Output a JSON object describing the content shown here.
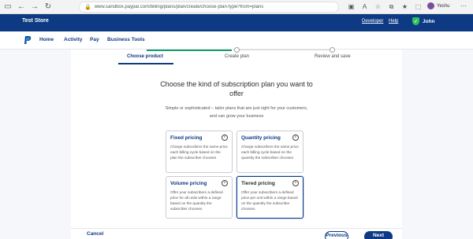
{
  "browser": {
    "url": "www.sandbox.paypal.com/billing/plans/plan/create/choose-plan-type?from=plans",
    "profile_name": "Yeshu"
  },
  "header": {
    "store_name": "Test Store",
    "developer_label": "Developer",
    "help_label": "Help",
    "user_name": "John"
  },
  "nav": {
    "items": [
      {
        "label": "Home"
      },
      {
        "label": "Activity"
      },
      {
        "label": "Pay"
      },
      {
        "label": "Business Tools"
      }
    ]
  },
  "stepper": {
    "steps": [
      {
        "label": "Choose product",
        "state": "active"
      },
      {
        "label": "Create plan",
        "state": "current"
      },
      {
        "label": "Review and save",
        "state": "upcoming"
      }
    ]
  },
  "main": {
    "heading": "Choose the kind of subscription plan you want to offer",
    "subheading": "Simple or sophisticated – tailor plans that are just right for your customers, and can grow your business",
    "options": [
      {
        "title": "Fixed pricing",
        "description": "Charge subscribers the same price each billing cycle based on the plan the subscriber chooses",
        "selected": false
      },
      {
        "title": "Quantity pricing",
        "description": "Charge subscribers the same price each billing cycle based on the quantity the subscriber chooses",
        "selected": false
      },
      {
        "title": "Volume pricing",
        "description": "Offer your subscribers a defined price for all units within a range based on the quantity the subscriber chooses",
        "selected": false
      },
      {
        "title": "Tiered pricing",
        "description": "Offer your subscribers a defined price per unit within a range based on the quantity the subscriber chooses",
        "selected": true
      }
    ]
  },
  "footer": {
    "cancel_label": "Cancel",
    "previous_label": "Previous",
    "next_label": "Next"
  },
  "colors": {
    "brand_dark": "#0d3a83",
    "progress": "#1a9b70"
  }
}
